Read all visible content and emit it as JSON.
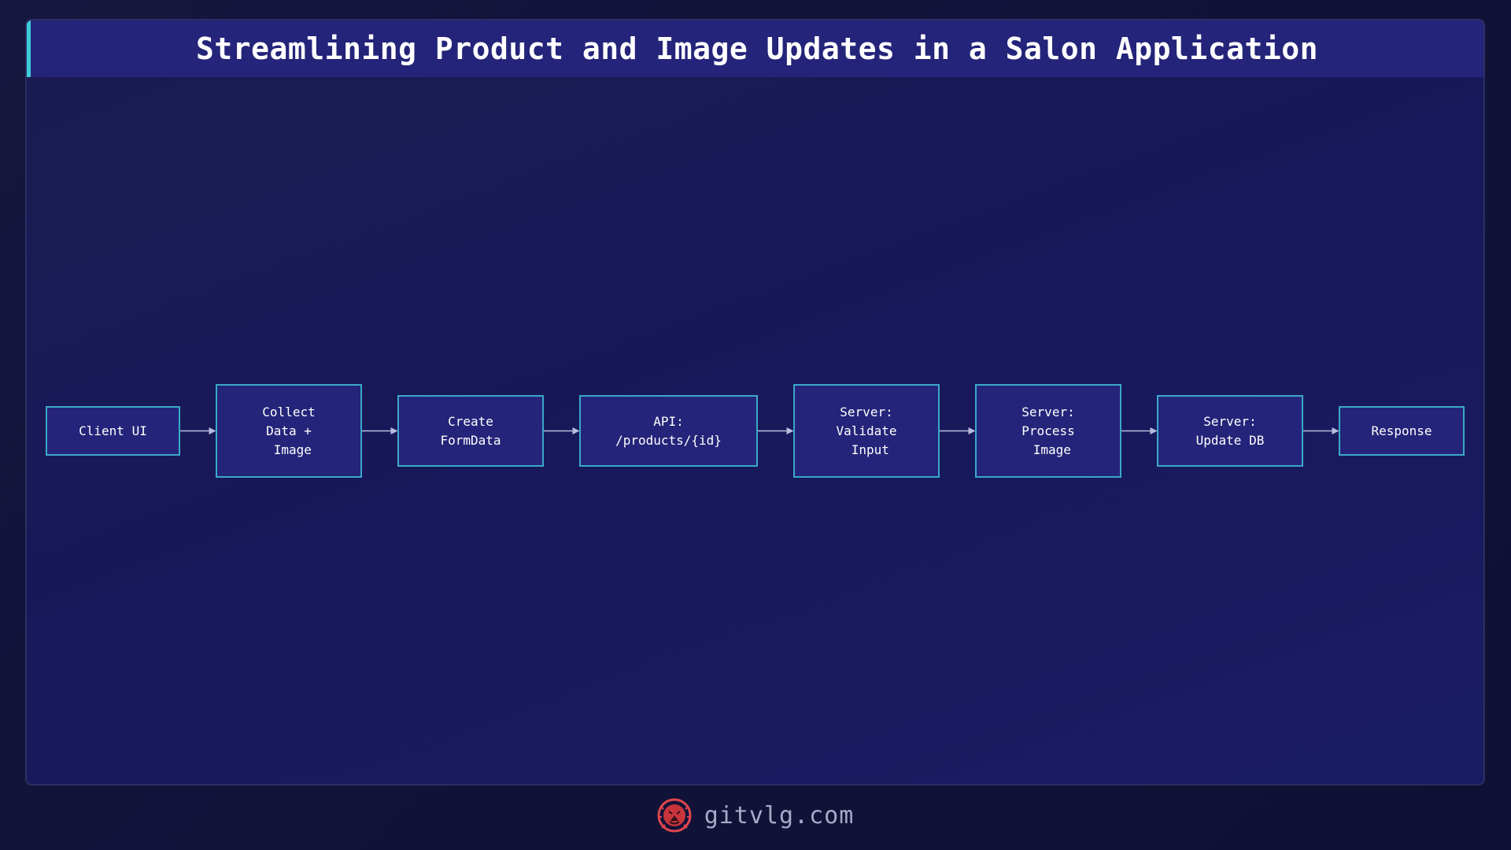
{
  "title": "Streamlining Product and Image Updates in a Salon Application",
  "diagram": {
    "nodes": [
      {
        "id": "client-ui",
        "label": "Client UI"
      },
      {
        "id": "collect-data",
        "label": "Collect\nData +\n Image"
      },
      {
        "id": "create-formdata",
        "label": "Create\nFormData"
      },
      {
        "id": "api-endpoint",
        "label": "API:\n/products/{id}"
      },
      {
        "id": "server-validate",
        "label": "Server:\nValidate\n Input"
      },
      {
        "id": "server-process",
        "label": "Server:\nProcess\n Image"
      },
      {
        "id": "server-update",
        "label": "Server:\nUpdate DB"
      },
      {
        "id": "response",
        "label": "Response"
      }
    ],
    "edges": [
      [
        "client-ui",
        "collect-data"
      ],
      [
        "collect-data",
        "create-formdata"
      ],
      [
        "create-formdata",
        "api-endpoint"
      ],
      [
        "api-endpoint",
        "server-validate"
      ],
      [
        "server-validate",
        "server-process"
      ],
      [
        "server-process",
        "server-update"
      ],
      [
        "server-update",
        "response"
      ]
    ]
  },
  "footer": {
    "site": "gitvlg.com",
    "logo_icon": "lion-head-icon"
  },
  "colors": {
    "node_fill": "#24247a",
    "node_border": "#3aa9c9",
    "edge": "#b8bde0",
    "accent": "#3ccfd8",
    "logo": "#e0474c"
  }
}
